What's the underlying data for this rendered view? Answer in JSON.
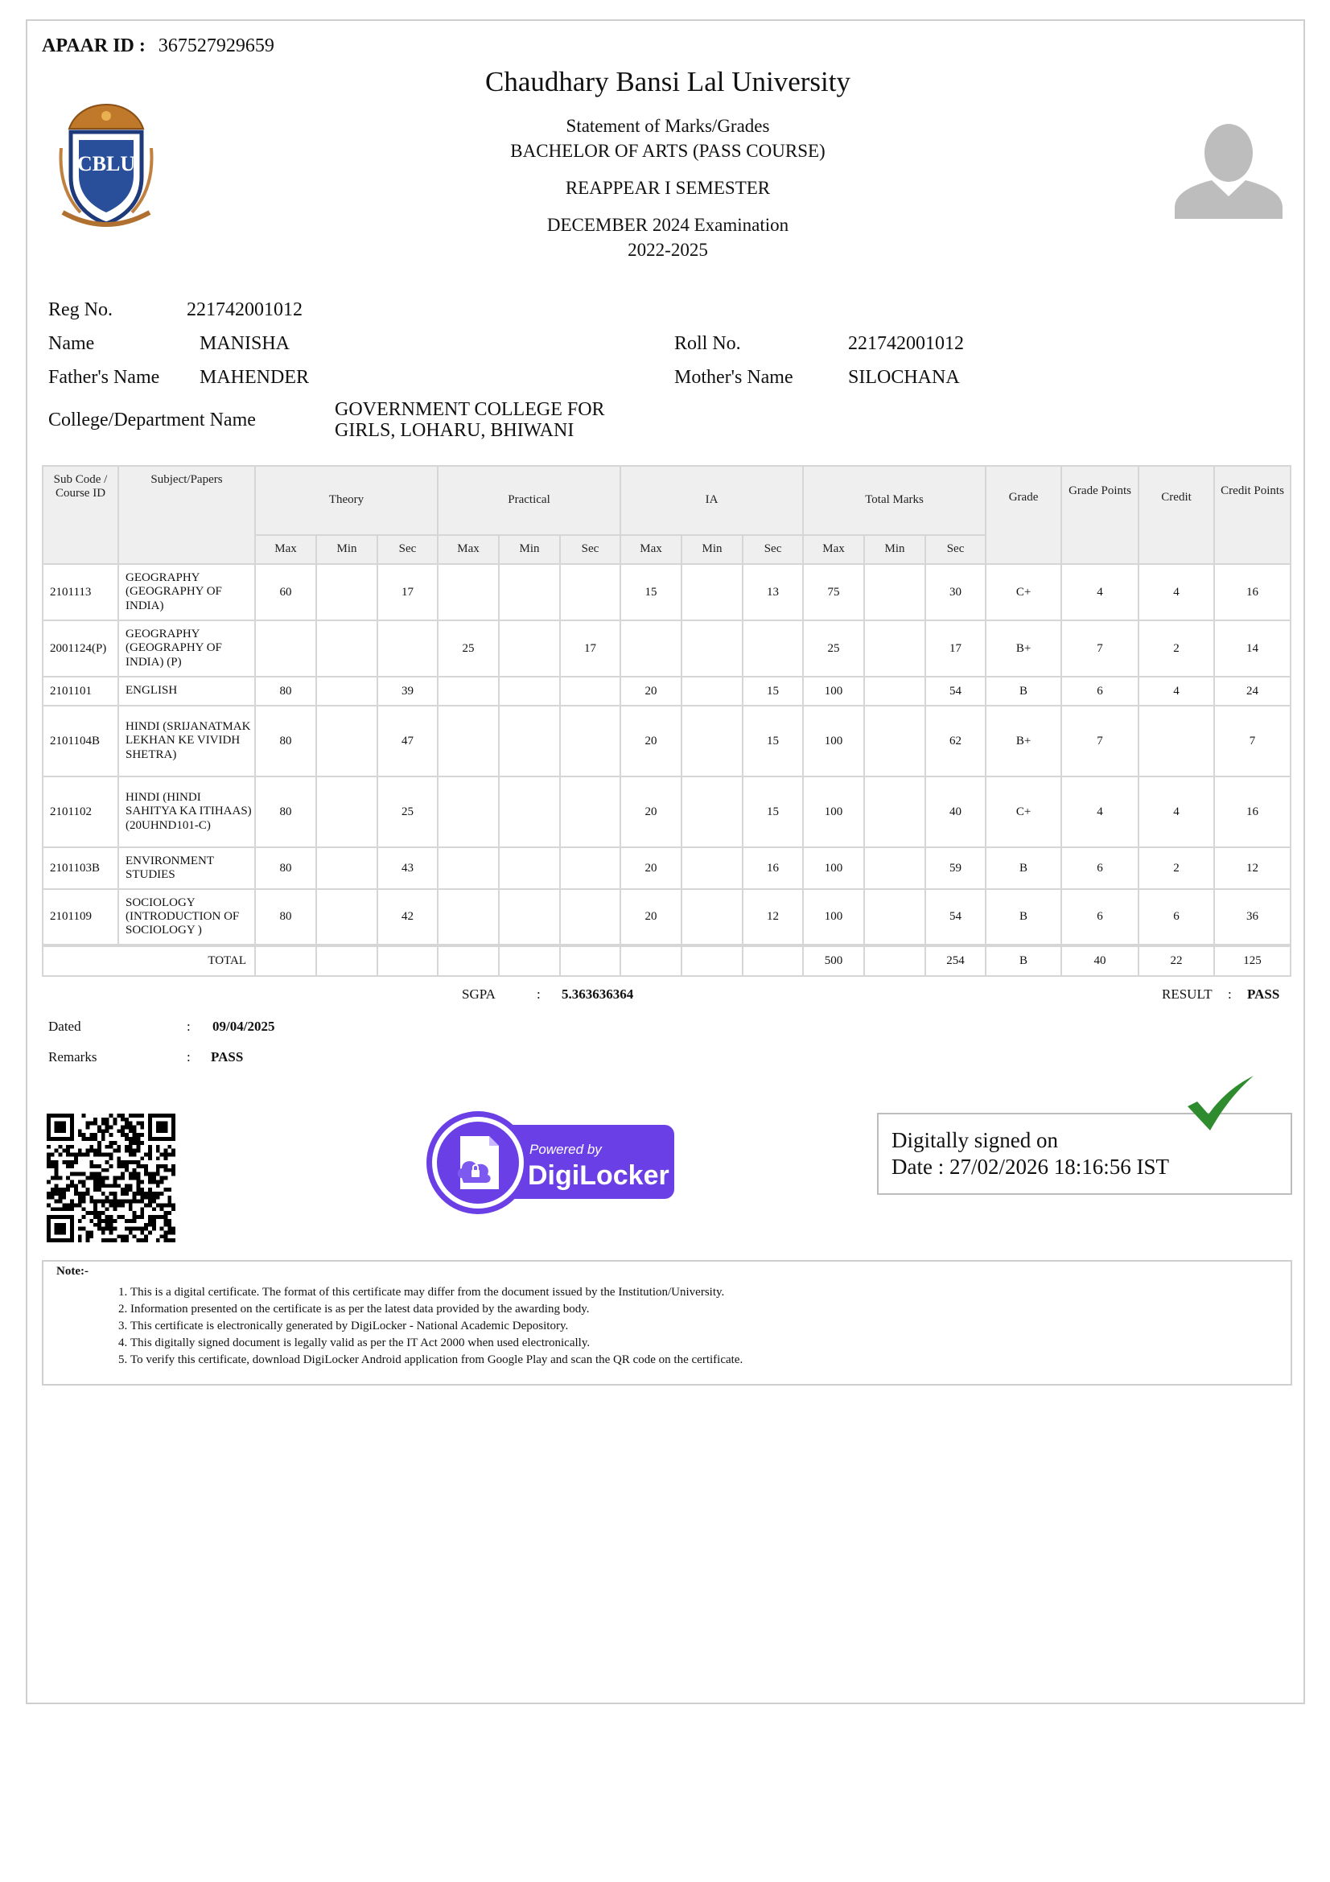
{
  "apaar": {
    "label": "APAAR ID :",
    "value": "367527929659"
  },
  "header": {
    "university": "Chaudhary Bansi Lal University",
    "statement": "Statement of Marks/Grades",
    "course": "BACHELOR OF ARTS (PASS COURSE)",
    "semester": "REAPPEAR I SEMESTER",
    "exam": "DECEMBER 2024 Examination",
    "session": "2022-2025"
  },
  "logo": {
    "text": "CBLU"
  },
  "student": {
    "reg_label": "Reg No.",
    "reg": "221742001012",
    "name_label": "Name",
    "name": "MANISHA",
    "roll_label": "Roll No.",
    "roll": "221742001012",
    "father_label": "Father's Name",
    "father": "MAHENDER",
    "mother_label": "Mother's Name",
    "mother": "SILOCHANA",
    "college_label": "College/Department Name",
    "college_line1": "GOVERNMENT COLLEGE FOR",
    "college_line2": "GIRLS, LOHARU, BHIWANI"
  },
  "table": {
    "headers": {
      "sub_code": "Sub Code / Course ID",
      "subject": "Subject/Papers",
      "theory": "Theory",
      "practical": "Practical",
      "ia": "IA",
      "total": "Total Marks",
      "grade": "Grade",
      "grade_points": "Grade Points",
      "credit": "Credit",
      "credit_points": "Credit Points",
      "max": "Max",
      "min": "Min",
      "sec": "Sec"
    },
    "rows": [
      {
        "code": "2101113",
        "subject": "GEOGRAPHY (GEOGRAPHY OF INDIA)",
        "t_max": "60",
        "t_min": "",
        "t_sec": "17",
        "p_max": "",
        "p_min": "",
        "p_sec": "",
        "i_max": "15",
        "i_min": "",
        "i_sec": "13",
        "tot_max": "75",
        "tot_min": "",
        "tot_sec": "30",
        "grade": "C+",
        "gp": "4",
        "credit": "4",
        "cp": "16"
      },
      {
        "code": "2001124(P)",
        "subject": "GEOGRAPHY (GEOGRAPHY OF INDIA) (P)",
        "t_max": "",
        "t_min": "",
        "t_sec": "",
        "p_max": "25",
        "p_min": "",
        "p_sec": "17",
        "i_max": "",
        "i_min": "",
        "i_sec": "",
        "tot_max": "25",
        "tot_min": "",
        "tot_sec": "17",
        "grade": "B+",
        "gp": "7",
        "credit": "2",
        "cp": "14"
      },
      {
        "code": "2101101",
        "subject": "ENGLISH",
        "t_max": "80",
        "t_min": "",
        "t_sec": "39",
        "p_max": "",
        "p_min": "",
        "p_sec": "",
        "i_max": "20",
        "i_min": "",
        "i_sec": "15",
        "tot_max": "100",
        "tot_min": "",
        "tot_sec": "54",
        "grade": "B",
        "gp": "6",
        "credit": "4",
        "cp": "24"
      },
      {
        "code": "2101104B",
        "subject": "HINDI (SRIJANATMAK LEKHAN KE VIVIDH SHETRA)",
        "t_max": "80",
        "t_min": "",
        "t_sec": "47",
        "p_max": "",
        "p_min": "",
        "p_sec": "",
        "i_max": "20",
        "i_min": "",
        "i_sec": "15",
        "tot_max": "100",
        "tot_min": "",
        "tot_sec": "62",
        "grade": "B+",
        "gp": "7",
        "credit": "",
        "cp": "7"
      },
      {
        "code": "2101102",
        "subject": "HINDI (HINDI SAHITYA KA ITIHAAS) (20UHND101-C)",
        "t_max": "80",
        "t_min": "",
        "t_sec": "25",
        "p_max": "",
        "p_min": "",
        "p_sec": "",
        "i_max": "20",
        "i_min": "",
        "i_sec": "15",
        "tot_max": "100",
        "tot_min": "",
        "tot_sec": "40",
        "grade": "C+",
        "gp": "4",
        "credit": "4",
        "cp": "16"
      },
      {
        "code": "2101103B",
        "subject": "ENVIRONMENT STUDIES",
        "t_max": "80",
        "t_min": "",
        "t_sec": "43",
        "p_max": "",
        "p_min": "",
        "p_sec": "",
        "i_max": "20",
        "i_min": "",
        "i_sec": "16",
        "tot_max": "100",
        "tot_min": "",
        "tot_sec": "59",
        "grade": "B",
        "gp": "6",
        "credit": "2",
        "cp": "12"
      },
      {
        "code": "2101109",
        "subject": "SOCIOLOGY (INTRODUCTION OF SOCIOLOGY )",
        "t_max": "80",
        "t_min": "",
        "t_sec": "42",
        "p_max": "",
        "p_min": "",
        "p_sec": "",
        "i_max": "20",
        "i_min": "",
        "i_sec": "12",
        "tot_max": "100",
        "tot_min": "",
        "tot_sec": "54",
        "grade": "B",
        "gp": "6",
        "credit": "6",
        "cp": "36"
      }
    ],
    "total": {
      "label": "TOTAL",
      "tot_max": "500",
      "tot_sec": "254",
      "grade": "B",
      "gp": "40",
      "credit": "22",
      "cp": "125"
    }
  },
  "summary": {
    "sgpa_label": "SGPA",
    "colon": ":",
    "sgpa": "5.363636364",
    "result_label": "RESULT",
    "result": "PASS",
    "dated_label": "Dated",
    "dated": "09/04/2025",
    "remarks_label": "Remarks",
    "remarks": "PASS"
  },
  "digilocker": {
    "powered": "Powered by",
    "brand": "DigiLocker",
    "color": "#6a40e6"
  },
  "signature": {
    "line1": "Digitally signed on",
    "line2": "Date : 27/02/2026 18:16:56 IST",
    "tick_color": "#2e8b2e"
  },
  "notes": {
    "title": "Note:-",
    "items": [
      "This is a digital certificate. The format of this certificate may differ from the document issued by the Institution/University.",
      "Information presented on the certificate is as per the latest data provided by the awarding body.",
      "This certificate is electronically generated by DigiLocker - National Academic Depository.",
      "This digitally signed document is legally valid as per the IT Act 2000 when used electronically.",
      "To verify this certificate, download DigiLocker Android application from Google Play and scan the QR code on the certificate."
    ]
  }
}
